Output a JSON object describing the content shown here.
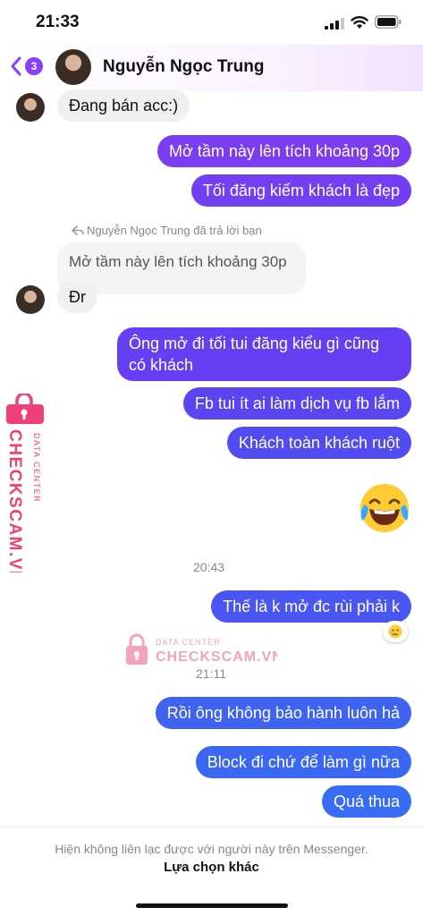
{
  "status_bar": {
    "time": "21:33"
  },
  "header": {
    "unread_count": "3",
    "contact_name": "Nguyễn Ngọc Trung"
  },
  "messages": {
    "m0": "Đang bán acc:)",
    "m1": "Mở tầm này lên tích khoảng 30p",
    "m2": "Tối đăng kiếm khách là đẹp",
    "reply_note": "Nguyễn Ngọc Trung đã trả lời bạn",
    "quoted": "Mở tầm này lên tích khoảng 30p",
    "m3": "Đr",
    "m4_line1": "Ông mở đi tối tui đăng kiểu gì cũng",
    "m4_line2": "có khách",
    "m5": "Fb tui ít ai làm dịch vụ fb lắm",
    "m6": "Khách toàn khách ruột",
    "time_1": "20:43",
    "m7": "Thế là k mở đc rùi phải k",
    "time_2": "21:11",
    "m8": "Rồi ông không bảo hành luôn hả",
    "m9": "Block đi chứ để làm gì nữa",
    "m10": "Quá thua"
  },
  "icons": {
    "emoji_message": "laughing-tears-emoji",
    "reaction": "crying-face-emoji",
    "reply_icon": "reply-arrow-icon"
  },
  "watermark": {
    "line1": "DATA CENTER",
    "line2": "CHECKSCAM.VN"
  },
  "footer": {
    "notice": "Hiện không liên lạc được với người này trên Messenger.",
    "action": "Lựa chọn khác"
  },
  "colors": {
    "accent": "#8b3dff",
    "outgoing_top": "#7c3cf2",
    "outgoing_bottom": "#3d6cf2",
    "watermark": "#f0407a"
  }
}
